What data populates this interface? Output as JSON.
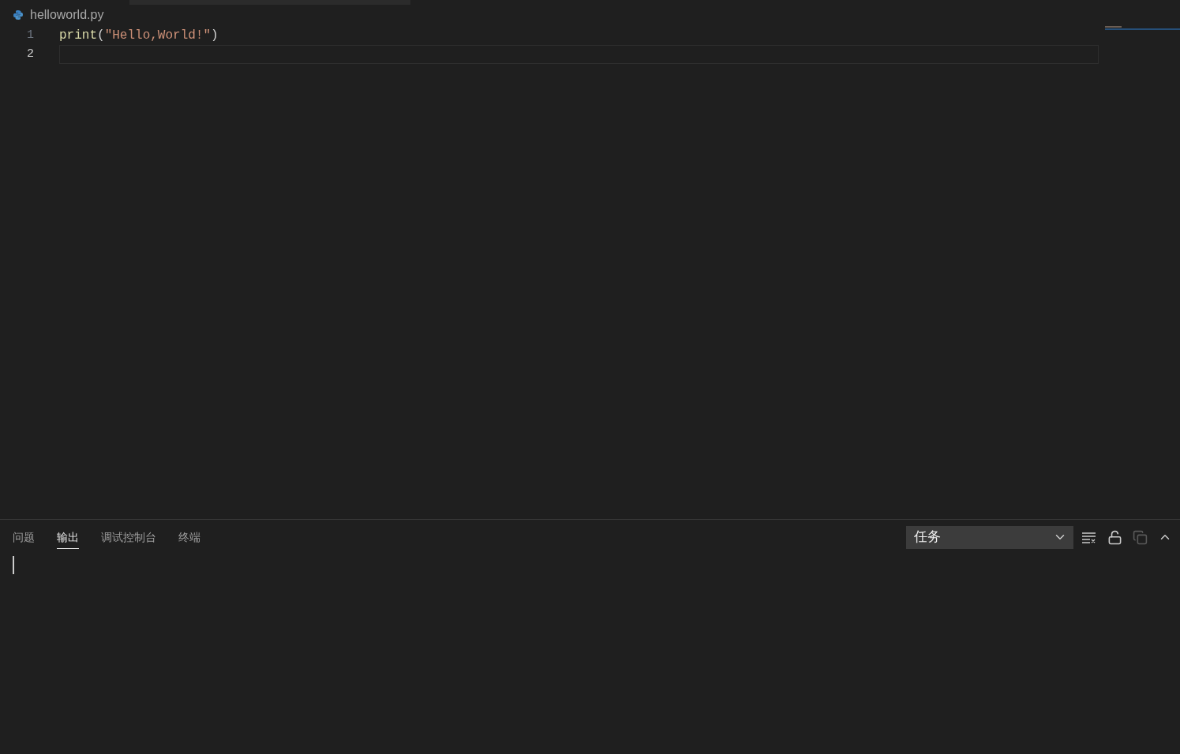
{
  "breadcrumb": {
    "file": "helloworld.py"
  },
  "editor": {
    "lines": [
      {
        "number": "1",
        "current": false,
        "tokens": [
          {
            "kind": "function",
            "text": "print"
          },
          {
            "kind": "punct",
            "text": "("
          },
          {
            "kind": "string",
            "text": "\"Hello,World!\""
          },
          {
            "kind": "punct",
            "text": ")"
          }
        ]
      },
      {
        "number": "2",
        "current": true
      }
    ]
  },
  "panel": {
    "tabs": [
      {
        "label": "问题",
        "selected": false
      },
      {
        "label": "输出",
        "selected": true
      },
      {
        "label": "调试控制台",
        "selected": false
      },
      {
        "label": "终端",
        "selected": false
      }
    ],
    "channel_select": {
      "value": "任务"
    }
  }
}
